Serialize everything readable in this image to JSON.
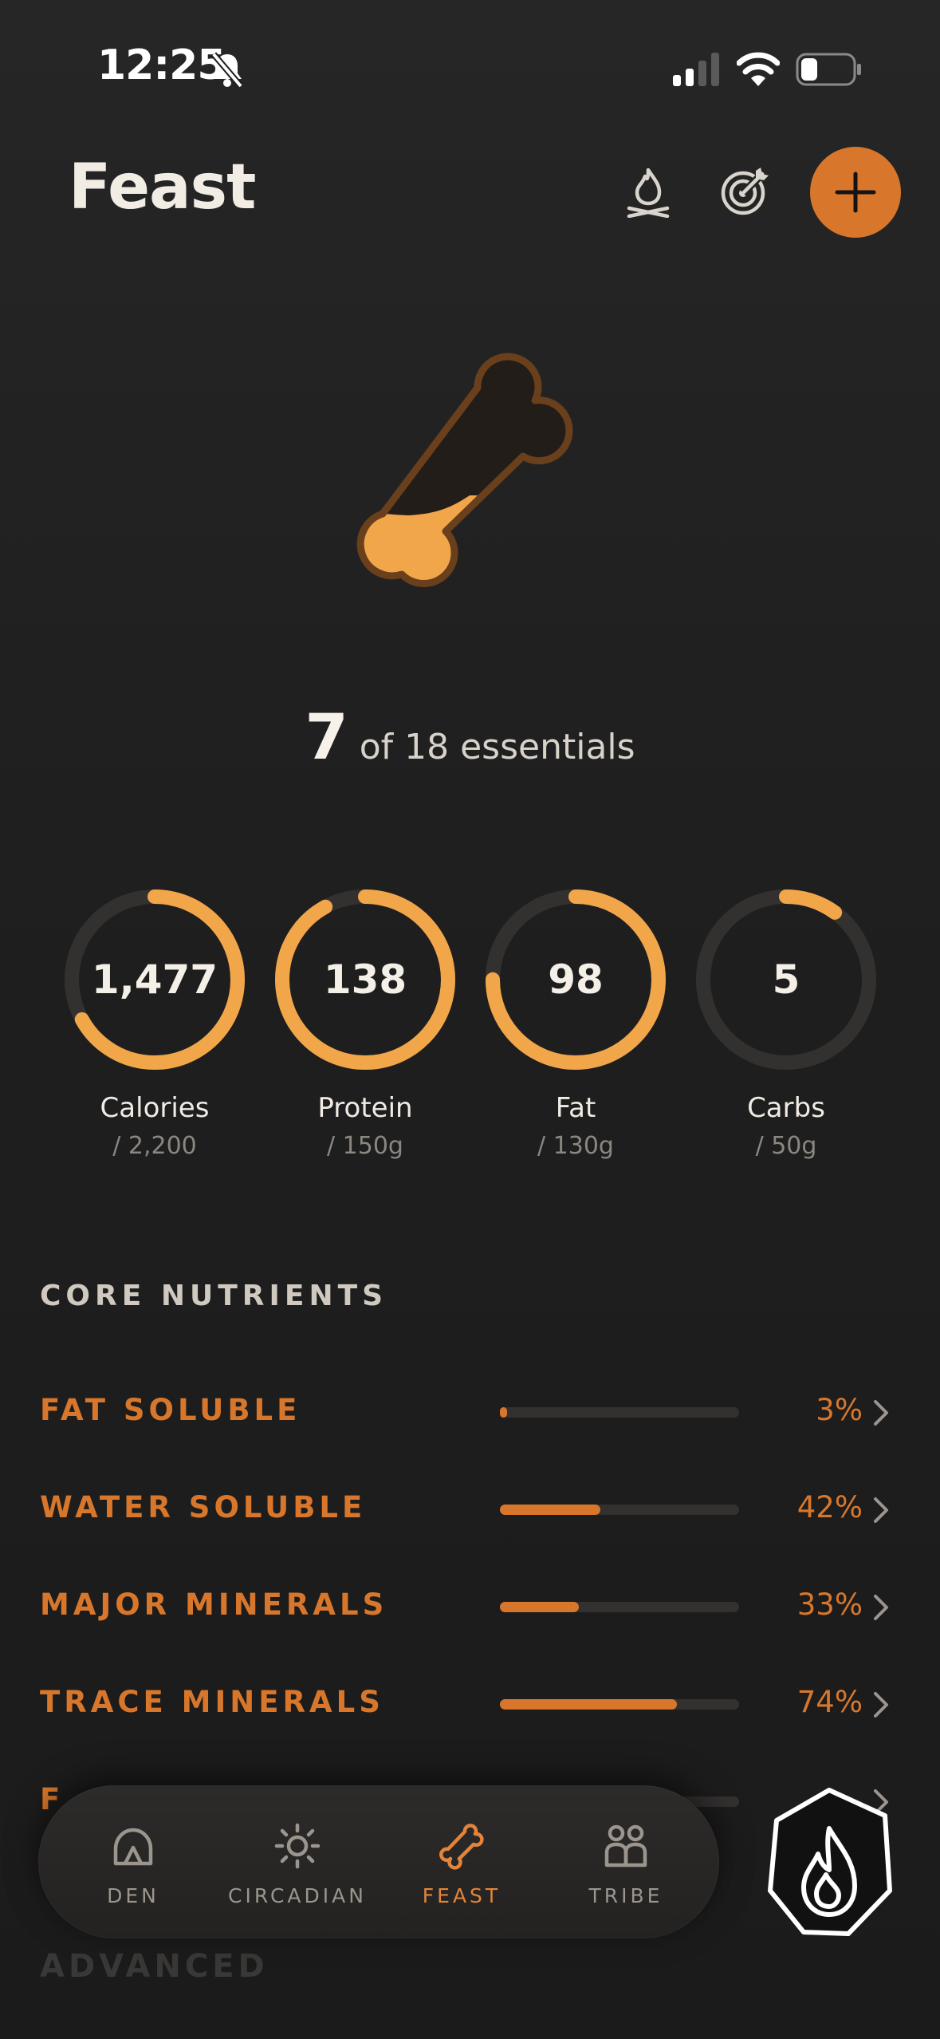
{
  "status_bar": {
    "time": "12:25",
    "icons": [
      "silent-mode-icon",
      "cellular-signal-icon",
      "wifi-icon",
      "battery-icon"
    ]
  },
  "header": {
    "title": "Feast",
    "actions": [
      "campfire-icon",
      "target-icon",
      "plus-icon"
    ]
  },
  "hero": {
    "icon": "bone-icon",
    "count": "7",
    "of_text": "of 18 essentials",
    "fill_fraction": 0.39
  },
  "macros": [
    {
      "value": "1,477",
      "label": "Calories",
      "target": "/ 2,200",
      "progress": 0.67
    },
    {
      "value": "138",
      "label": "Protein",
      "target": "/ 150g",
      "progress": 0.92
    },
    {
      "value": "98",
      "label": "Fat",
      "target": "/ 130g",
      "progress": 0.75
    },
    {
      "value": "5",
      "label": "Carbs",
      "target": "/ 50g",
      "progress": 0.1
    }
  ],
  "core_nutrients": {
    "title": "CORE NUTRIENTS",
    "rows": [
      {
        "name": "FAT SOLUBLE",
        "percent": "3%",
        "progress": 0.03
      },
      {
        "name": "WATER SOLUBLE",
        "percent": "42%",
        "progress": 0.42
      },
      {
        "name": "MAJOR MINERALS",
        "percent": "33%",
        "progress": 0.33
      },
      {
        "name": "TRACE MINERALS",
        "percent": "74%",
        "progress": 0.74
      }
    ],
    "partial_row_letter": "F",
    "next_section_text": "ADVANCED"
  },
  "tabs": [
    {
      "label": "DEN",
      "icon": "den-icon",
      "active": false
    },
    {
      "label": "CIRCADIAN",
      "icon": "sun-icon",
      "active": false
    },
    {
      "label": "FEAST",
      "icon": "bone-icon",
      "active": true
    },
    {
      "label": "TRIBE",
      "icon": "people-icon",
      "active": false
    }
  ],
  "fab": {
    "icon": "flame-icon"
  },
  "colors": {
    "accent": "#d8772b",
    "ring_fill": "#f2a64a",
    "background": "#1f1f1f",
    "track": "#333130"
  }
}
